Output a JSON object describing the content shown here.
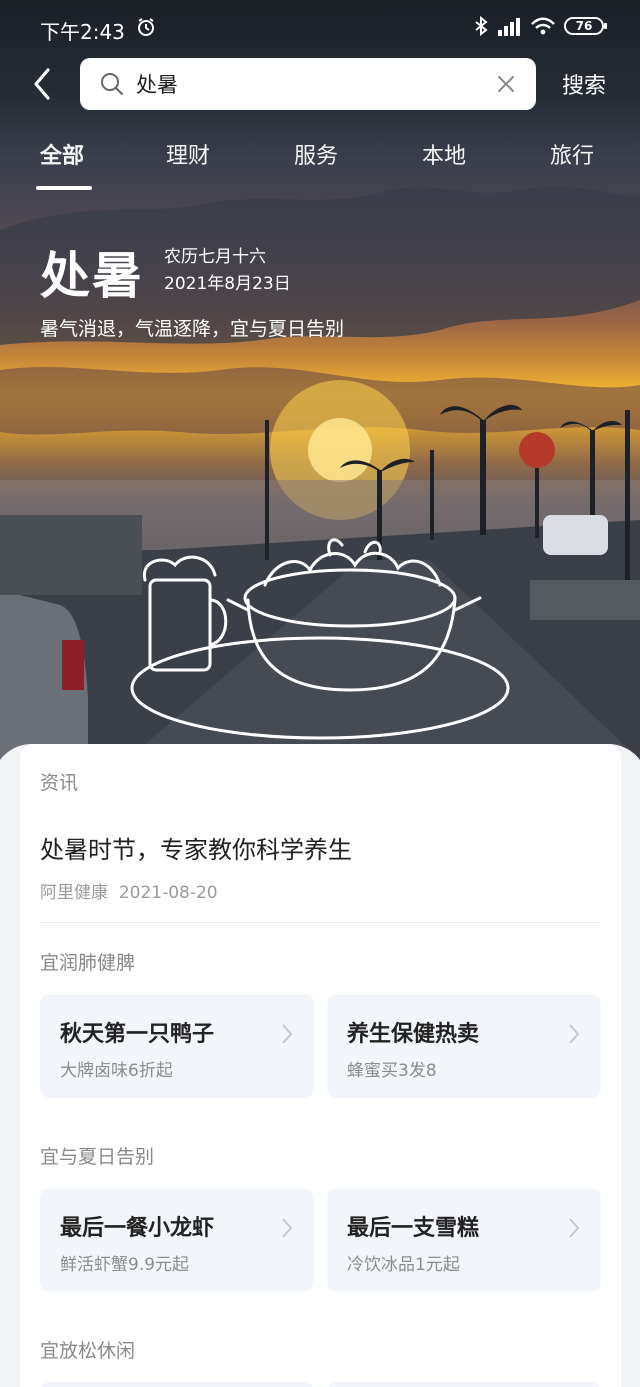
{
  "status_bar": {
    "time": "下午2:43",
    "battery": "76",
    "icons": [
      "alarm-icon",
      "bluetooth-icon",
      "signal-icon",
      "wifi-icon",
      "battery-icon"
    ]
  },
  "search": {
    "query": "处暑",
    "button_label": "搜索",
    "icons": [
      "back-icon",
      "search-icon",
      "clear-icon"
    ]
  },
  "tabs": [
    {
      "label": "全部",
      "active": true
    },
    {
      "label": "理财",
      "active": false
    },
    {
      "label": "服务",
      "active": false
    },
    {
      "label": "本地",
      "active": false
    },
    {
      "label": "旅行",
      "active": false
    }
  ],
  "solar_term": {
    "name": "处暑",
    "lunar_date": "农历七月十六",
    "date": "2021年8月23日",
    "description": "暑气消退，气温逐降，宜与夏日告别"
  },
  "news": {
    "section_label": "资讯",
    "title": "处暑时节，专家教你科学养生",
    "source": "阿里健康",
    "date": "2021-08-20"
  },
  "groups": [
    {
      "label": "宜润肺健脾",
      "items": [
        {
          "title": "秋天第一只鸭子",
          "subtitle": "大牌卤味6折起"
        },
        {
          "title": "养生保健热卖",
          "subtitle": "蜂蜜买3发8"
        }
      ]
    },
    {
      "label": "宜与夏日告别",
      "items": [
        {
          "title": "最后一餐小龙虾",
          "subtitle": "鲜活虾蟹9.9元起"
        },
        {
          "title": "最后一支雪糕",
          "subtitle": "冷饮冰品1元起"
        }
      ]
    },
    {
      "label": "宜放松休闲",
      "items": []
    }
  ],
  "colors": {
    "card_bg": "#ffffff",
    "tile_bg": "#f2f6fb",
    "page_bg": "#f2f3f5",
    "sunset": "#f2b630"
  }
}
